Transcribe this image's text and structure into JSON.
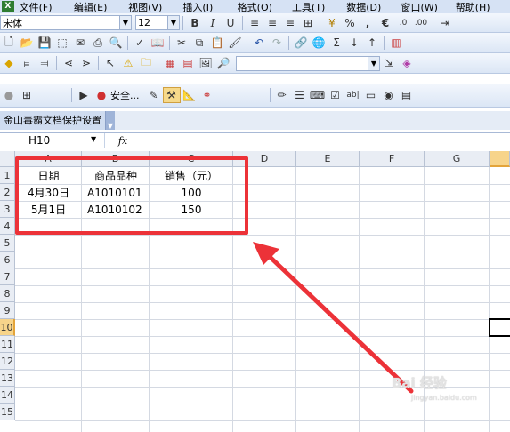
{
  "menu": {
    "items": [
      "文件(F)",
      "编辑(E)",
      "视图(V)",
      "插入(I)",
      "格式(O)",
      "工具(T)",
      "数据(D)",
      "窗口(W)",
      "帮助(H)"
    ]
  },
  "format_toolbar": {
    "font_name": "宋体",
    "font_size": "12",
    "bold": "B",
    "italic": "I",
    "underline": "U",
    "percent": "%",
    "comma": ",",
    "euro": "€",
    "sum": "Σ"
  },
  "security_toolbar": {
    "security_label": "安全..."
  },
  "doc_tab": {
    "label": "金山毒霸文档保护设置"
  },
  "formula_bar": {
    "name_box": "H10",
    "fx": "fx"
  },
  "sheet": {
    "columns": [
      "A",
      "B",
      "C",
      "D",
      "E",
      "F",
      "G"
    ],
    "rows": [
      "1",
      "2",
      "3",
      "4",
      "5",
      "6",
      "7",
      "8",
      "9",
      "10",
      "11",
      "12",
      "13",
      "14",
      "15"
    ],
    "data": [
      [
        "日期",
        "商品品种",
        "销售（元）"
      ],
      [
        "4月30日",
        "A1010101",
        "100"
      ],
      [
        "5月1日",
        "A1010102",
        "150"
      ]
    ],
    "selected_cell": "H10"
  },
  "watermark": {
    "text": "Bai 经验",
    "url": "jingyan.baidu.com"
  },
  "colors": {
    "highlight": "#ec3238",
    "arrow": "#ec3238"
  }
}
